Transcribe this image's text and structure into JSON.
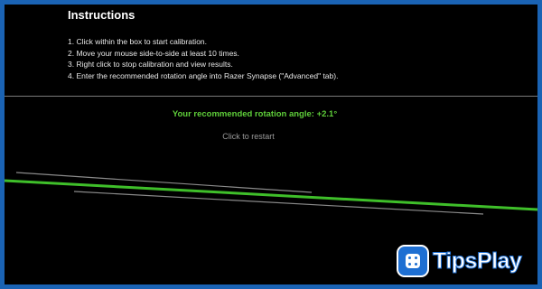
{
  "instructions": {
    "title": "Instructions",
    "steps": [
      "1. Click within the box to start calibration.",
      "2. Move your mouse side-to-side at least 10 times.",
      "3. Right click to stop calibration and view results.",
      "4. Enter the recommended rotation angle into Razer Synapse (\"Advanced\" tab)."
    ]
  },
  "result": {
    "text": "Your recommended rotation angle: +2.1°",
    "color": "#5fcf3a"
  },
  "restart_label": "Click to restart",
  "logo": {
    "text": "TipsPlay",
    "icon": "dice-icon"
  },
  "colors": {
    "border": "#1a63b4",
    "background": "#000000",
    "fit_line": "#3fbf2a",
    "trace_lines": "#8a8a8a"
  }
}
